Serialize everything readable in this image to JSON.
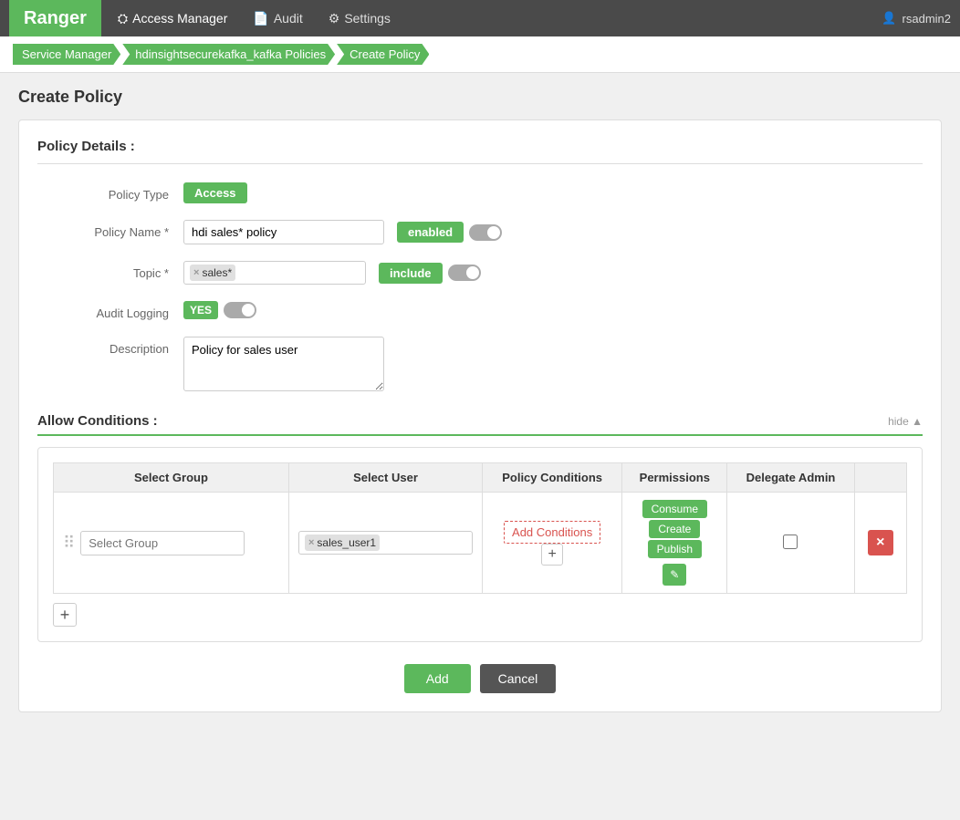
{
  "brand": "Ranger",
  "nav": {
    "items": [
      {
        "label": "Access Manager",
        "icon": "shield",
        "active": true
      },
      {
        "label": "Audit",
        "icon": "file",
        "active": false
      },
      {
        "label": "Settings",
        "icon": "gear",
        "active": false
      }
    ],
    "user": "rsadmin2"
  },
  "breadcrumb": {
    "items": [
      {
        "label": "Service Manager"
      },
      {
        "label": "hdinsightsecurekafka_kafka Policies"
      },
      {
        "label": "Create Policy"
      }
    ]
  },
  "page_title": "Create Policy",
  "policy_details": {
    "section_title": "Policy Details :",
    "policy_type_label": "Policy Type",
    "policy_type_value": "Access",
    "policy_name_label": "Policy Name *",
    "policy_name_value": "hdi sales* policy",
    "enabled_label": "enabled",
    "topic_label": "Topic *",
    "topic_tag": "sales*",
    "include_label": "include",
    "audit_logging_label": "Audit Logging",
    "audit_yes_label": "YES",
    "description_label": "Description",
    "description_value": "Policy for sales user"
  },
  "allow_conditions": {
    "title": "Allow Conditions :",
    "hide_label": "hide ▲",
    "table": {
      "col_group": "Select Group",
      "col_user": "Select User",
      "col_conditions": "Policy Conditions",
      "col_permissions": "Permissions",
      "col_delegate": "Delegate Admin"
    },
    "row": {
      "group_placeholder": "Select Group",
      "user_tag": "sales_user1",
      "add_conditions_label": "Add Conditions",
      "permissions": [
        "Consume",
        "Create",
        "Publish"
      ]
    }
  },
  "actions": {
    "add_label": "Add",
    "cancel_label": "Cancel"
  }
}
